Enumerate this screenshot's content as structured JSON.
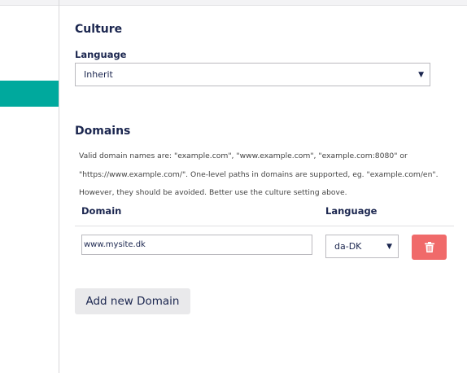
{
  "culture": {
    "title": "Culture",
    "language_label": "Language",
    "language_value": "Inherit"
  },
  "domains": {
    "title": "Domains",
    "help_lines": [
      "Valid domain names are: \"example.com\", \"www.example.com\", \"example.com:8080\" or",
      "\"https://www.example.com/\". One-level paths in domains are supported, eg. \"example.com/en\".",
      "However, they should be avoided. Better use the culture setting above."
    ],
    "columns": {
      "domain": "Domain",
      "language": "Language"
    },
    "rows": [
      {
        "domain": "www.mysite.dk",
        "language": "da-DK"
      }
    ],
    "add_button": "Add new Domain"
  },
  "icons": {
    "dropdown": "chevron-down-icon",
    "delete": "trash-icon"
  },
  "colors": {
    "accent": "#00a99d",
    "danger": "#f06a6a",
    "text": "#1b264f"
  }
}
